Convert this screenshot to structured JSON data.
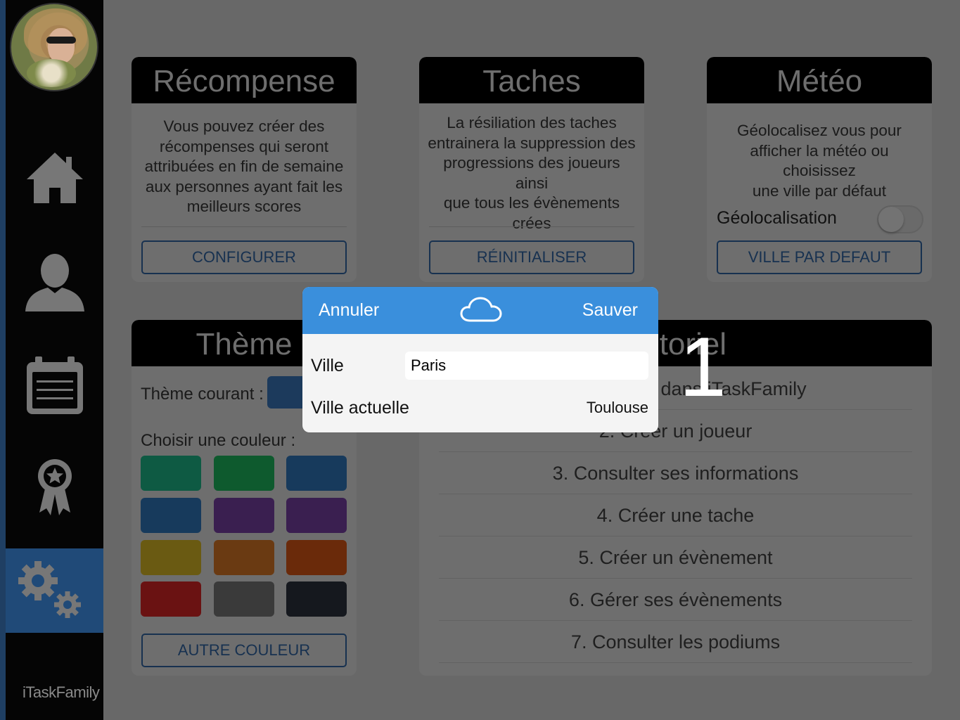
{
  "app": {
    "brand": "iTaskFamily"
  },
  "sidebar": {
    "items": [
      {
        "icon": "home-icon"
      },
      {
        "icon": "user-icon"
      },
      {
        "icon": "calendar-icon"
      },
      {
        "icon": "award-icon"
      },
      {
        "icon": "settings-icon",
        "active": true
      }
    ]
  },
  "recompense": {
    "title": "Récompense",
    "lines": [
      "Vous pouvez créer des",
      "récompenses qui seront",
      "attribuées en fin de semaine",
      "aux personnes ayant fait les",
      "meilleurs scores"
    ],
    "button": "CONFIGURER"
  },
  "taches": {
    "title": "Taches",
    "lines": [
      "La résiliation des taches",
      "entrainera la suppression des",
      "progressions des joueurs ainsi",
      "que tous les évènements",
      "crées"
    ],
    "button": "RÉINITIALISER"
  },
  "meteo": {
    "title": "Météo",
    "lines": [
      "Géolocalisez vous pour",
      "afficher la météo ou choisissez",
      "une ville par défaut"
    ],
    "geoloc_label": "Géolocalisation",
    "geoloc_on": false,
    "button": "VILLE PAR DEFAUT"
  },
  "theme": {
    "title": "Thème",
    "current_label": "Thème courant :",
    "choose_label": "Choisir une couleur :",
    "current_color": "#1c3a5c",
    "swatches": [
      "#0e5a43",
      "#0e5a2e",
      "#173a5c",
      "#173a5c",
      "#3a1f50",
      "#3a1f50",
      "#6a5a12",
      "#6a3a12",
      "#6a2a0a",
      "#6a1212",
      "#3a3a3a",
      "#15181e"
    ],
    "button": "AUTRE COULEUR"
  },
  "tutoriel": {
    "title": "Tutoriel",
    "items": [
      "1. Bienvenue dans iTaskFamily",
      "2. Créer un joueur",
      "3. Consulter ses informations",
      "4. Créer une tache",
      "5. Créer un évènement",
      "6. Gérer ses évènements",
      "7. Consulter les podiums"
    ]
  },
  "modal": {
    "cancel": "Annuler",
    "save": "Sauver",
    "icon": "cloud-icon",
    "ville_label": "Ville",
    "ville_value": "Paris",
    "current_label": "Ville actuelle",
    "current_value": "Toulouse"
  },
  "overlay_digit": "1"
}
